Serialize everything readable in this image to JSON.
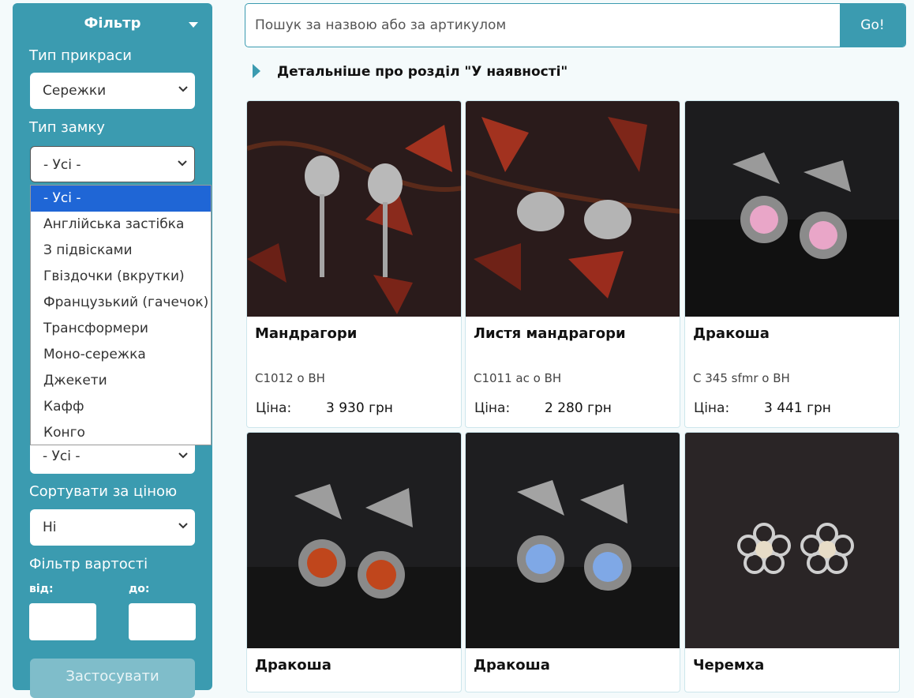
{
  "sidebar": {
    "title": "Фільтр",
    "type_label": "Тип прикраси",
    "type_value": "Сережки",
    "lock_label": "Тип замку",
    "lock_value": "- Усі -",
    "hidden_value": "- Усі -",
    "sort_label": "Сортувати за ціною",
    "sort_value": "Ні",
    "price_filter_label": "Фільтр вартості",
    "from_label": "від:",
    "to_label": "до:",
    "apply_label": "Застосувати"
  },
  "lock_options": [
    "- Усі -",
    "Англійська застібка",
    "З підвісками",
    "Гвіздочки (вкрутки)",
    "Французький (гачечок)",
    "Трансформери",
    "Моно-сережка",
    "Джекети",
    "Кафф",
    "Конго"
  ],
  "search": {
    "placeholder": "Пошук за назвою або за артикулом",
    "button": "Go!"
  },
  "more_info": "Детальніше про розділ \"У наявності\"",
  "price_label": "Ціна:",
  "products": [
    {
      "title": "Мандрагори",
      "code": "С1012 о ВН",
      "price": "3 930 грн"
    },
    {
      "title": "Листя мандрагори",
      "code": "С1011 ас о ВН",
      "price": "2 280 грн"
    },
    {
      "title": "Дракоша",
      "code": "С 345 sfmr о ВН",
      "price": "3 441 грн"
    },
    {
      "title": "Дракоша"
    },
    {
      "title": "Дракоша"
    },
    {
      "title": "Черемха"
    }
  ],
  "colors": {
    "accent": "#3b9bb0",
    "selected_option": "#1f66d6"
  }
}
